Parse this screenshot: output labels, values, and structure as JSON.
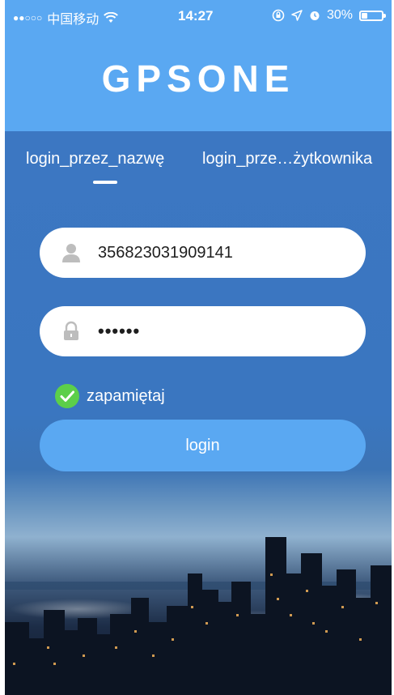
{
  "status_bar": {
    "signal": "●●○○○",
    "carrier": "中国移动",
    "time": "14:27",
    "battery": "30%",
    "battery_level": 0.3
  },
  "header": {
    "title": "GPSONE",
    "color": "#5aa8f2"
  },
  "tabs": {
    "name_tab": "login_przez_nazwę",
    "user_tab": "login_prze…żytkownika"
  },
  "form": {
    "username_value": "356823031909141",
    "password_mask": "••••••",
    "remember_label": "zapamiętaj",
    "login_label": "login"
  },
  "colors": {
    "accent": "#5aa8f2",
    "check": "#5ccf4a"
  }
}
